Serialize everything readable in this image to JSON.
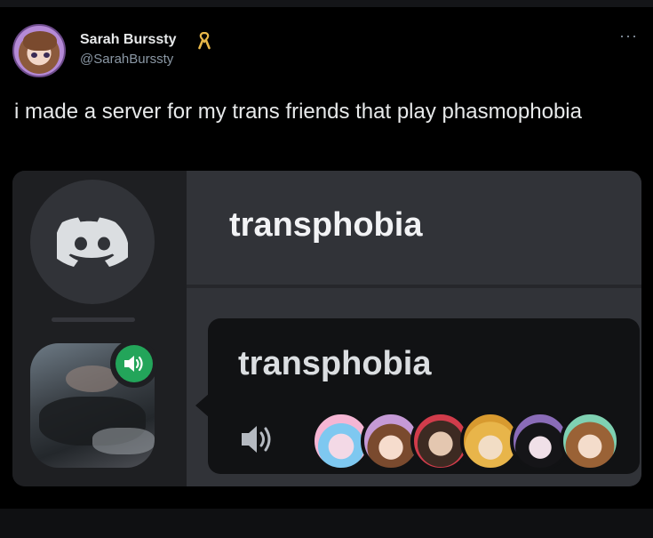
{
  "tweet": {
    "display_name": "Sarah Burssty",
    "badge_icon": "ribbon-icon",
    "handle": "@SarahBurssty",
    "more_label": "···",
    "text": "i made a server for my trans friends that play phasmophobia"
  },
  "discord": {
    "header_channel_name": "transphobia",
    "popup_channel_name": "transphobia",
    "colors": {
      "rail": "#1e1f22",
      "panel": "#313338",
      "popup": "#111214",
      "voice_green": "#23a55a"
    },
    "voice_members": [
      "member-1",
      "member-2",
      "member-3",
      "member-4",
      "member-5",
      "member-6"
    ]
  }
}
